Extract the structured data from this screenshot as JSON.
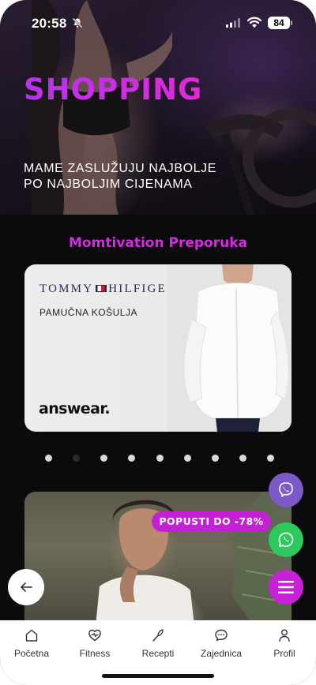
{
  "status_bar": {
    "time": "20:58",
    "battery": "84",
    "icons": [
      "bell-slash-icon",
      "signal-icon",
      "wifi-icon",
      "battery-icon"
    ]
  },
  "hero": {
    "title": "SHOPPING",
    "subtitle": "MAME ZASLUŽUJU NAJBOLJE\nPO NAJBOLJIM CIJENAMA"
  },
  "section": {
    "title": "Momtivation Preporuka"
  },
  "featured_card": {
    "brand_left": "TOMMY",
    "brand_right": "HILFIGER",
    "product": "PAMUČNA KOŠULJA",
    "shop": "answear."
  },
  "carousel": {
    "total": 9,
    "active_index": 1
  },
  "promo_card": {
    "badge": "POPUSTI DO -78%"
  },
  "floating_buttons": [
    "viber-icon",
    "whatsapp-icon",
    "menu-icon"
  ],
  "tabbar": {
    "tabs": [
      {
        "label": "Početna",
        "icon": "home-icon"
      },
      {
        "label": "Fitness",
        "icon": "heart-pulse-icon"
      },
      {
        "label": "Recepti",
        "icon": "whisk-icon"
      },
      {
        "label": "Zajednica",
        "icon": "chat-bubble-icon"
      },
      {
        "label": "Profil",
        "icon": "user-icon"
      }
    ]
  },
  "colors": {
    "accent": "#c822d6",
    "title_gradient": [
      "#b633f0",
      "#e22ad8"
    ],
    "background": "#0b0a0c",
    "viber": "#7b59c7",
    "whatsapp": "#2ec95c"
  }
}
